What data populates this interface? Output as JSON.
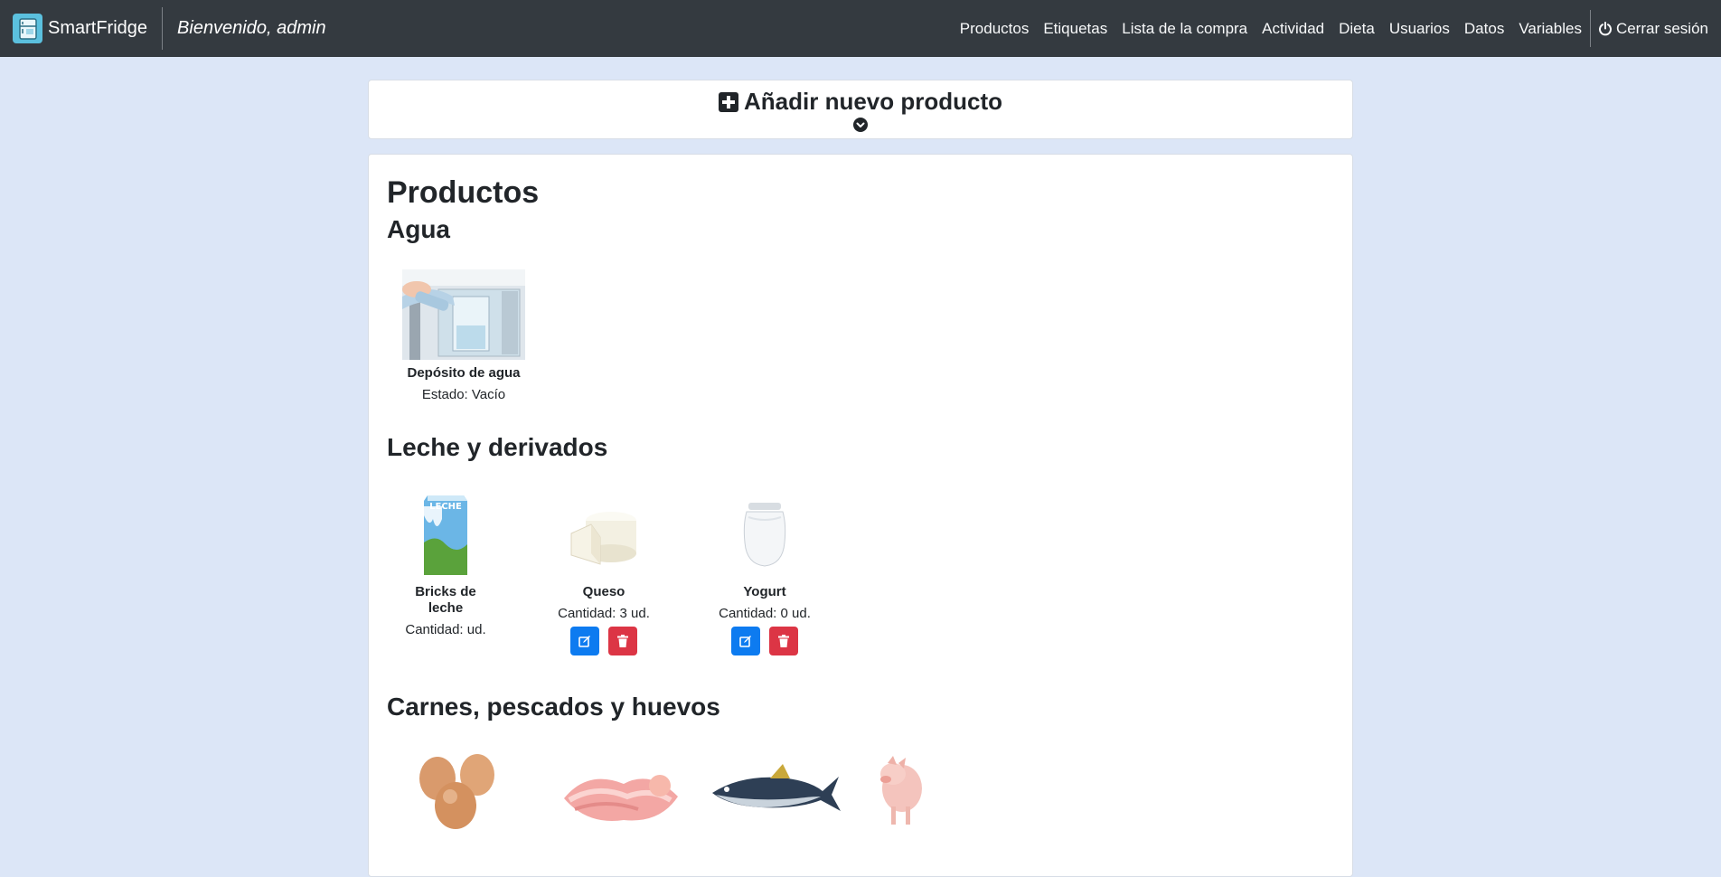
{
  "app": {
    "name": "SmartFridge",
    "welcome": "Bienvenido, admin"
  },
  "nav": {
    "items": [
      {
        "label": "Productos"
      },
      {
        "label": "Etiquetas"
      },
      {
        "label": "Lista de la compra"
      },
      {
        "label": "Actividad"
      },
      {
        "label": "Dieta"
      },
      {
        "label": "Usuarios"
      },
      {
        "label": "Datos"
      },
      {
        "label": "Variables"
      }
    ],
    "logout": "Cerrar sesión"
  },
  "add_card": {
    "title": "Añadir nuevo producto"
  },
  "main": {
    "title": "Productos",
    "categories": [
      {
        "name": "Agua",
        "products": [
          {
            "name": "Depósito de agua",
            "info": "Estado: Vacío",
            "icon": "water-dispenser-image"
          }
        ]
      },
      {
        "name": "Leche y derivados",
        "products": [
          {
            "name": "Bricks de leche",
            "info": "Cantidad: ud.",
            "icon": "milk-carton-image",
            "brand_text": "LECHE"
          },
          {
            "name": "Queso",
            "info": "Cantidad: 3 ud.",
            "icon": "cheese-image"
          },
          {
            "name": "Yogurt",
            "info": "Cantidad: 0 ud.",
            "icon": "yogurt-jar-image"
          }
        ]
      },
      {
        "name": "Carnes, pescados y huevos",
        "products": [
          {
            "icon": "eggs-image"
          },
          {
            "icon": "ham-slices-image"
          },
          {
            "icon": "tuna-fish-image"
          },
          {
            "icon": "pig-image"
          }
        ]
      }
    ]
  },
  "colors": {
    "navbar": "#343a40",
    "background": "#dce6f7",
    "edit": "#0d7bf0",
    "delete": "#dc3545",
    "brand": "#5bc0de"
  }
}
